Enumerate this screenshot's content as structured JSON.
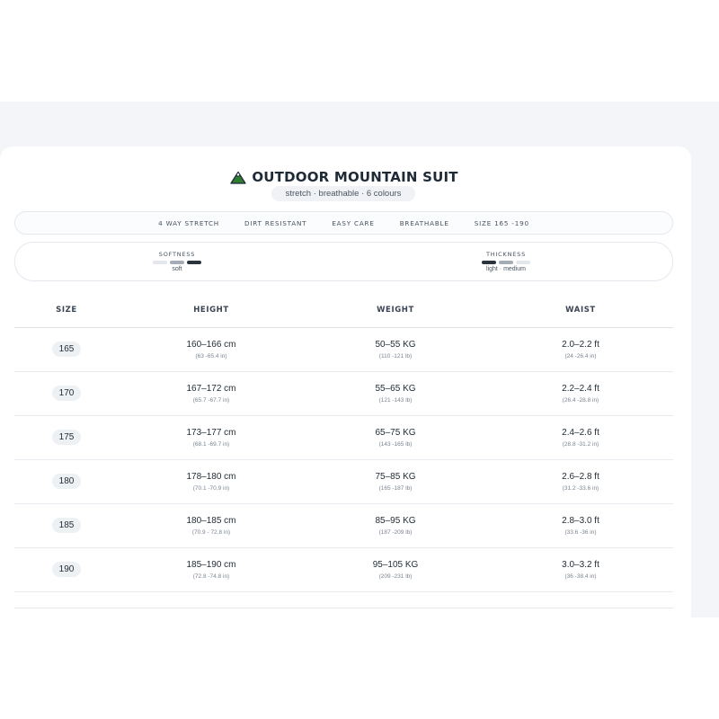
{
  "product": {
    "title": "OUTDOOR MOUNTAIN SUIT",
    "subtitle": "stretch · breathable · 6 colours",
    "icon": "mountain-icon",
    "icon_colors": {
      "peak": "#2e7d32",
      "snow": "#ffffff",
      "outline": "#1f2a37"
    }
  },
  "features": [
    "4 WAY STRETCH",
    "DIRT RESISTANT",
    "EASY CARE",
    "BREATHABLE",
    "SIZE 165 -190"
  ],
  "metrics": {
    "softness": {
      "label": "SOFTNESS",
      "value": "soft",
      "levels": [
        "low",
        "mid",
        "high"
      ],
      "highlight": "high"
    },
    "thickness": {
      "label": "THICKNESS",
      "value": "light · medium",
      "levels": [
        "low",
        "mid",
        "high"
      ],
      "highlight": "low-mid"
    }
  },
  "table": {
    "headers": {
      "size": "SIZE",
      "height": "HEIGHT",
      "weight": "WEIGHT",
      "waist": "WAIST"
    },
    "rows": [
      {
        "size": "165",
        "height": "160–166 cm",
        "height_in": "(63 -65.4 in)",
        "weight": "50–55 KG",
        "weight_lb": "(110 -121 lb)",
        "waist": "2.0–2.2 ft",
        "waist_in": "(24 -26.4 in)"
      },
      {
        "size": "170",
        "height": "167–172 cm",
        "height_in": "(65.7 -67.7 in)",
        "weight": "55–65 KG",
        "weight_lb": "(121 -143 lb)",
        "waist": "2.2–2.4 ft",
        "waist_in": "(26.4 -28.8 in)"
      },
      {
        "size": "175",
        "height": "173–177 cm",
        "height_in": "(68.1 -69.7 in)",
        "weight": "65–75 KG",
        "weight_lb": "(143 -165 lb)",
        "waist": "2.4–2.6 ft",
        "waist_in": "(28.8 -31.2 in)"
      },
      {
        "size": "180",
        "height": "178–180 cm",
        "height_in": "(70.1 -70.9 in)",
        "weight": "75–85 KG",
        "weight_lb": "(165 -187 lb)",
        "waist": "2.6–2.8 ft",
        "waist_in": "(31.2 -33.6 in)"
      },
      {
        "size": "185",
        "height": "180–185 cm",
        "height_in": "(70.9 - 72.8 in)",
        "weight": "85–95 KG",
        "weight_lb": "(187 -209 lb)",
        "waist": "2.8–3.0 ft",
        "waist_in": "(33.6 -36 in)"
      },
      {
        "size": "190",
        "height": "185–190 cm",
        "height_in": "(72.8 -74.8 in)",
        "weight": "95–105 KG",
        "weight_lb": "(209 -231 lb)",
        "waist": "3.0–3.2 ft",
        "waist_in": "(36 -38.4 in)"
      }
    ]
  }
}
